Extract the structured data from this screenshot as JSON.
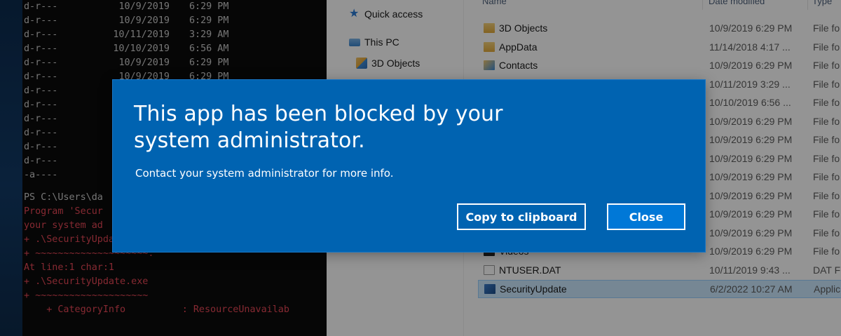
{
  "console": {
    "listing": [
      {
        "mode": "d-r---",
        "date": "10/9/2019",
        "time": "6:29 PM"
      },
      {
        "mode": "d-r---",
        "date": "10/9/2019",
        "time": "6:29 PM"
      },
      {
        "mode": "d-r---",
        "date": "10/11/2019",
        "time": "3:29 AM"
      },
      {
        "mode": "d-r---",
        "date": "10/10/2019",
        "time": "6:56 AM"
      },
      {
        "mode": "d-r---",
        "date": "10/9/2019",
        "time": "6:29 PM"
      },
      {
        "mode": "d-r---",
        "date": "10/9/2019",
        "time": "6:29 PM"
      },
      {
        "mode": "d-r---",
        "date": "",
        "time": ""
      },
      {
        "mode": "d-r---",
        "date": "",
        "time": ""
      },
      {
        "mode": "d-r---",
        "date": "",
        "time": ""
      },
      {
        "mode": "d-r---",
        "date": "",
        "time": ""
      },
      {
        "mode": "d-r---",
        "date": "",
        "time": ""
      },
      {
        "mode": "d-r---",
        "date": "",
        "time": ""
      },
      {
        "mode": "-a----",
        "date": "",
        "time": ""
      }
    ],
    "prompt": "PS C:\\Users\\da",
    "error_lines": [
      "Program 'Secur",
      "your system ad",
      "+ .\\SecurityUpdate.exe",
      "+ ~~~~~~~~~~~~~~~~~~~~.",
      "At line:1 char:1",
      "+ .\\SecurityUpdate.exe",
      "+ ~~~~~~~~~~~~~~~~~~~~",
      "    + CategoryInfo          : ResourceUnavailab"
    ]
  },
  "explorer": {
    "nav": {
      "quick_access": "Quick access",
      "this_pc": "This PC",
      "objects_3d": "3D Objects"
    },
    "columns": {
      "name": "Name",
      "date": "Date modified",
      "type": "Type"
    },
    "files": [
      {
        "name": "3D Objects",
        "date": "10/9/2019 6:29 PM",
        "type": "File fo",
        "icon": "3d-objects-icon"
      },
      {
        "name": "AppData",
        "date": "11/14/2018 4:17 ...",
        "type": "File fo",
        "icon": "folder-icon"
      },
      {
        "name": "Contacts",
        "date": "10/9/2019 6:29 PM",
        "type": "File fo",
        "icon": "contacts-icon"
      },
      {
        "name": "",
        "date": "10/11/2019 3:29 ...",
        "type": "File fo",
        "icon": "folder-icon"
      },
      {
        "name": "",
        "date": "10/10/2019 6:56 ...",
        "type": "File fo",
        "icon": "folder-icon"
      },
      {
        "name": "",
        "date": "10/9/2019 6:29 PM",
        "type": "File fo",
        "icon": "folder-icon"
      },
      {
        "name": "",
        "date": "10/9/2019 6:29 PM",
        "type": "File fo",
        "icon": "folder-icon"
      },
      {
        "name": "",
        "date": "10/9/2019 6:29 PM",
        "type": "File fo",
        "icon": "folder-icon"
      },
      {
        "name": "",
        "date": "10/9/2019 6:29 PM",
        "type": "File fo",
        "icon": "folder-icon"
      },
      {
        "name": "",
        "date": "10/9/2019 6:29 PM",
        "type": "File fo",
        "icon": "folder-icon"
      },
      {
        "name": "",
        "date": "10/9/2019 6:29 PM",
        "type": "File fo",
        "icon": "folder-icon"
      },
      {
        "name": "",
        "date": "10/9/2019 6:29 PM",
        "type": "File fo",
        "icon": "folder-icon"
      },
      {
        "name": "Videos",
        "date": "10/9/2019 6:29 PM",
        "type": "File fo",
        "icon": "videos-icon"
      },
      {
        "name": "NTUSER.DAT",
        "date": "10/11/2019 9:43 ...",
        "type": "DAT Fi",
        "icon": "file-icon"
      },
      {
        "name": "SecurityUpdate",
        "date": "6/2/2022 10:27 AM",
        "type": "Applic",
        "icon": "application-icon"
      }
    ]
  },
  "dialog": {
    "title": "This app has been blocked by your system administrator.",
    "message": "Contact your system administrator for more info.",
    "copy_button": "Copy to clipboard",
    "close_button": "Close",
    "accent_color": "#0063b1"
  }
}
